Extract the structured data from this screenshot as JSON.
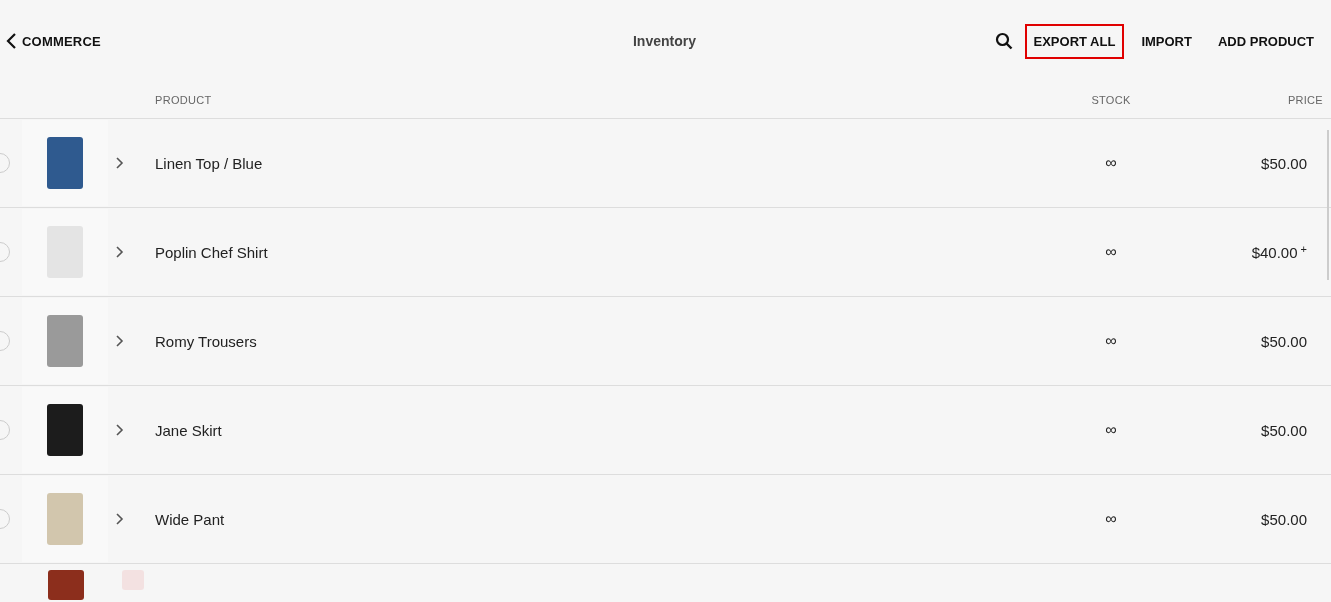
{
  "header": {
    "back_label": "COMMERCE",
    "title": "Inventory",
    "actions": [
      {
        "label": "EXPORT ALL",
        "highlighted": true
      },
      {
        "label": "IMPORT",
        "highlighted": false
      },
      {
        "label": "ADD PRODUCT",
        "highlighted": false
      }
    ]
  },
  "table": {
    "columns": [
      "PRODUCT",
      "STOCK",
      "PRICE"
    ],
    "rows": [
      {
        "color": "#2f5a8f",
        "name": "Linen Top / Blue",
        "stock": "∞",
        "price": "$50.00",
        "selected": false
      },
      {
        "color": "#e4e4e4",
        "name": "Poplin Chef Shirt",
        "stock": "∞",
        "price": "$40.00",
        "price_suffix": "+",
        "selected": false
      },
      {
        "color": "#9a9a9a",
        "name": "Romy Trousers",
        "stock": "∞",
        "price": "$50.00",
        "selected": false
      },
      {
        "color": "#1c1c1c",
        "name": "Jane Skirt",
        "stock": "∞",
        "price": "$50.00",
        "selected": false
      },
      {
        "color": "#d2c6ad",
        "name": "Wide Pant",
        "stock": "∞",
        "price": "$50.00",
        "selected": false
      },
      {
        "color": "#8c2e1c",
        "thumbnail": {
          "color": "#f3e1e1"
        }
      }
    ]
  }
}
